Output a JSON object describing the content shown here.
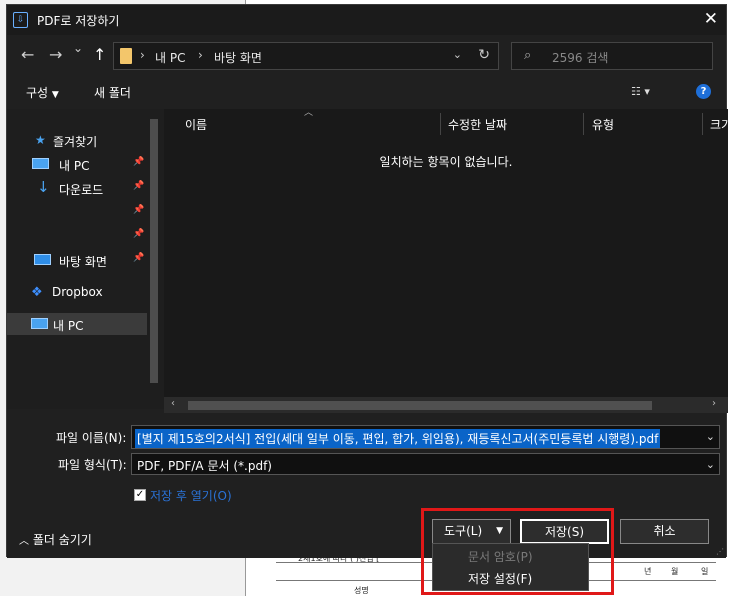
{
  "background_doc": {
    "line1": "2제1호에 따라 ( )전입 [",
    "cells": [
      "년",
      "월",
      "일"
    ],
    "line2": "성명"
  },
  "window": {
    "title": "PDF로 저장하기",
    "close_icon": "close-icon"
  },
  "nav": {
    "back": "←",
    "forward": "→",
    "recent": "⌄",
    "up": "↑",
    "breadcrumb": [
      "내 PC",
      "바탕 화면"
    ],
    "search_placeholder": "2596 검색"
  },
  "toolbar": {
    "organize": "구성",
    "new_folder": "새 폴더",
    "help": "?"
  },
  "sidebar": {
    "items": [
      {
        "label": "즐겨찾기",
        "icon": "star-icon"
      },
      {
        "label": "내 PC",
        "icon": "monitor-icon",
        "pinned": true
      },
      {
        "label": "다운로드",
        "icon": "download-icon",
        "pinned": true
      },
      {
        "label": "",
        "pinned": true
      },
      {
        "label": "",
        "pinned": true
      },
      {
        "label": "바탕 화면",
        "icon": "desktop-icon",
        "pinned": true
      },
      {
        "label": "Dropbox",
        "icon": "dropbox-icon"
      },
      {
        "label": "내 PC",
        "icon": "monitor-icon",
        "selected": true
      }
    ]
  },
  "filelist": {
    "columns": [
      "이름",
      "수정한 날짜",
      "유형",
      "크기"
    ],
    "empty_message": "일치하는 항목이 없습니다."
  },
  "form": {
    "filename_label": "파일 이름(N):",
    "filename_value": "[별지 제15호의2서식] 전입(세대 일부 이동, 편입, 합가, 위임용), 재등록신고서(주민등록법 시행령).pdf",
    "filetype_label": "파일 형식(T):",
    "filetype_value": "PDF, PDF/A 문서 (*.pdf)",
    "open_after_save_label": "저장 후 열기(O)",
    "open_after_save_checked": true,
    "hide_folders": "폴더 숨기기"
  },
  "buttons": {
    "tools": "도구(L)",
    "save": "저장(S)",
    "cancel": "취소"
  },
  "tools_menu": {
    "items": [
      {
        "label": "문서 암호(P)",
        "disabled": true
      },
      {
        "label": "저장 설정(F)",
        "disabled": false
      }
    ]
  },
  "colors": {
    "dialog_bg": "#202020",
    "selection_blue": "#0a64c8",
    "highlight_red": "#e01818",
    "link_blue": "#2a72d6"
  }
}
